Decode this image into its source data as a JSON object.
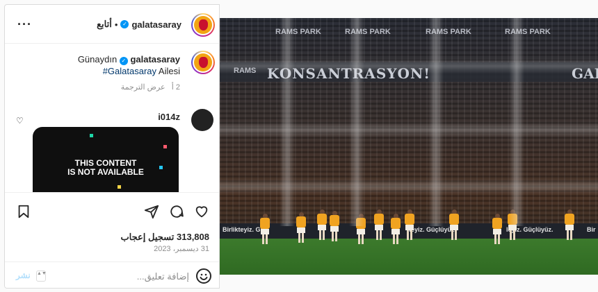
{
  "header": {
    "username": "galatasaray",
    "follow_label": "أتابع",
    "separator": "•",
    "more_label": "···"
  },
  "caption": {
    "username": "galatasaray",
    "greeting": "Günaydın",
    "hashtag": "#Galatasaray",
    "text_after": "Ailesi",
    "age": "2 أ",
    "translate_label": "عرض الترجمة"
  },
  "comment": {
    "username": "i014z",
    "card_line1": "THIS CONTENT",
    "card_line2": "IS NOT AVAILABLE"
  },
  "stats": {
    "likes": "313,808 تسجيل إعجاب",
    "date": "31 ديسمبر، 2023"
  },
  "comment_box": {
    "placeholder": "إضافة تعليق...",
    "post_label": "نشر",
    "spinner_glyph": "▲▼"
  },
  "photo": {
    "banner_text": "KONSANTRASYON!",
    "banner_right": "GAL",
    "sponsor": "RAMS PARK",
    "sponsor_2": "RAMS",
    "board_1": "Birlikteyiz. Güç",
    "board_2": "teyiz. Güçlüyüz.",
    "board_3": "leyiz. Güçlüyüz.",
    "board_4": "Bir"
  },
  "icons": {
    "more": "more-horizontal-icon",
    "verified": "verified-badge-icon",
    "heart": "heart-icon",
    "comment": "comment-icon",
    "share": "share-icon",
    "save": "bookmark-icon",
    "emoji": "emoji-icon"
  },
  "colors": {
    "link": "#00376b",
    "verified": "#0095f6",
    "post_disabled": "#b2dffc",
    "secondary_text": "#8e8e8e"
  }
}
